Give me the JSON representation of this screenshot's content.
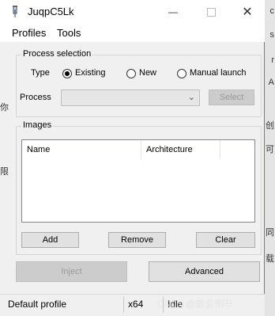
{
  "window": {
    "title": "JuqpC5Lk"
  },
  "menu": {
    "items": [
      "Profiles",
      "Tools"
    ]
  },
  "process_selection": {
    "group_title": "Process selection",
    "type_label": "Type",
    "options": [
      "Existing",
      "New",
      "Manual launch"
    ],
    "selected_option": "Existing",
    "process_label": "Process",
    "process_value": "",
    "select_button": "Select"
  },
  "images": {
    "group_title": "Images",
    "columns": [
      "Name",
      "Architecture"
    ],
    "rows": [],
    "add_button": "Add",
    "remove_button": "Remove",
    "clear_button": "Clear"
  },
  "actions": {
    "inject_button": "Inject",
    "advanced_button": "Advanced"
  },
  "status": {
    "profile": "Default profile",
    "arch": "x64",
    "state": "Idle"
  },
  "background": {
    "right_chars": [
      "c",
      "s",
      "r",
      "A",
      "创",
      "可",
      "同",
      "载"
    ],
    "left_chars": [
      "你",
      "限"
    ],
    "watermark": "CSDN @影目师平"
  },
  "icons": {
    "app": "syringe-icon",
    "minimize": "minimize-icon",
    "maximize": "maximize-icon",
    "close": "close-icon",
    "dropdown": "chevron-down-icon"
  }
}
